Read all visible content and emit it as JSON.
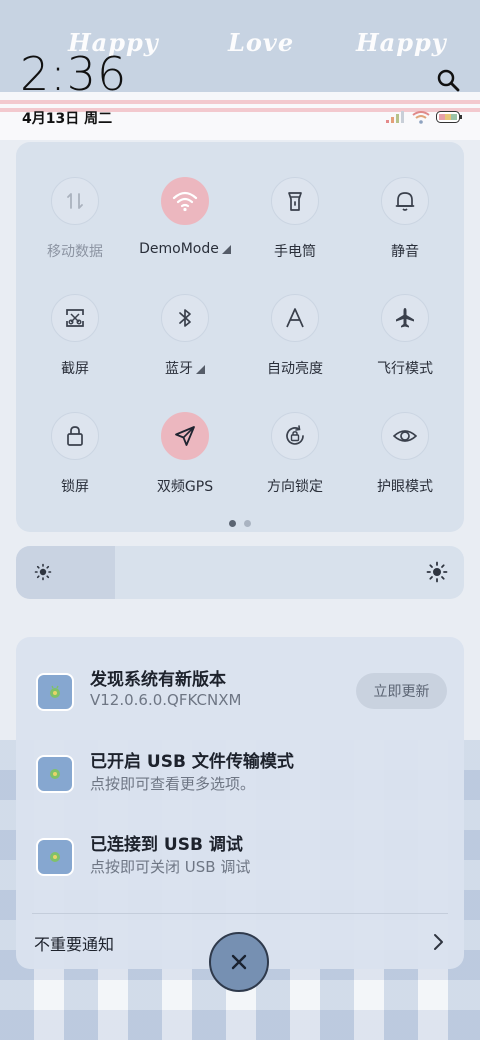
{
  "status_bar": {
    "time": "2:36",
    "date": "4月13日 周二",
    "icons": [
      "signal-icon",
      "wifi-icon",
      "battery-icon"
    ]
  },
  "wallpaper": {
    "doodle_words": [
      "Happy",
      "Love",
      "Happy"
    ]
  },
  "quick_settings": {
    "tiles": [
      {
        "label": "移动数据",
        "icon": "mobile-data-icon",
        "active": false,
        "dim": true
      },
      {
        "label": "DemoMode",
        "icon": "wifi-icon",
        "active": true,
        "dropdown": true
      },
      {
        "label": "手电筒",
        "icon": "flashlight-icon",
        "active": false
      },
      {
        "label": "静音",
        "icon": "bell-icon",
        "active": false
      },
      {
        "label": "截屏",
        "icon": "screenshot-icon",
        "active": false
      },
      {
        "label": "蓝牙",
        "icon": "bluetooth-icon",
        "active": false,
        "dropdown": true
      },
      {
        "label": "自动亮度",
        "icon": "auto-brightness-icon",
        "active": false
      },
      {
        "label": "飞行模式",
        "icon": "airplane-icon",
        "active": false
      },
      {
        "label": "锁屏",
        "icon": "lock-icon",
        "active": false
      },
      {
        "label": "双频GPS",
        "icon": "gps-icon",
        "active": true
      },
      {
        "label": "方向锁定",
        "icon": "rotation-lock-icon",
        "active": false
      },
      {
        "label": "护眼模式",
        "icon": "eye-icon",
        "active": false
      }
    ],
    "page_count": 2,
    "current_page": 1
  },
  "brightness": {
    "level": 0.22
  },
  "notifications": [
    {
      "title": "发现系统有新版本",
      "subtitle": "V12.0.6.0.QFKCNXM",
      "action": "立即更新"
    },
    {
      "title": "已开启 USB 文件传输模式",
      "subtitle": "点按即可查看更多选项。"
    },
    {
      "title": "已连接到 USB 调试",
      "subtitle": "点按即可关闭 USB 调试"
    }
  ],
  "minor_notifications_label": "不重要通知",
  "colors": {
    "tile_active": "#ecb7bf",
    "panel": "#d6dfec",
    "fab": "#7690b2"
  }
}
